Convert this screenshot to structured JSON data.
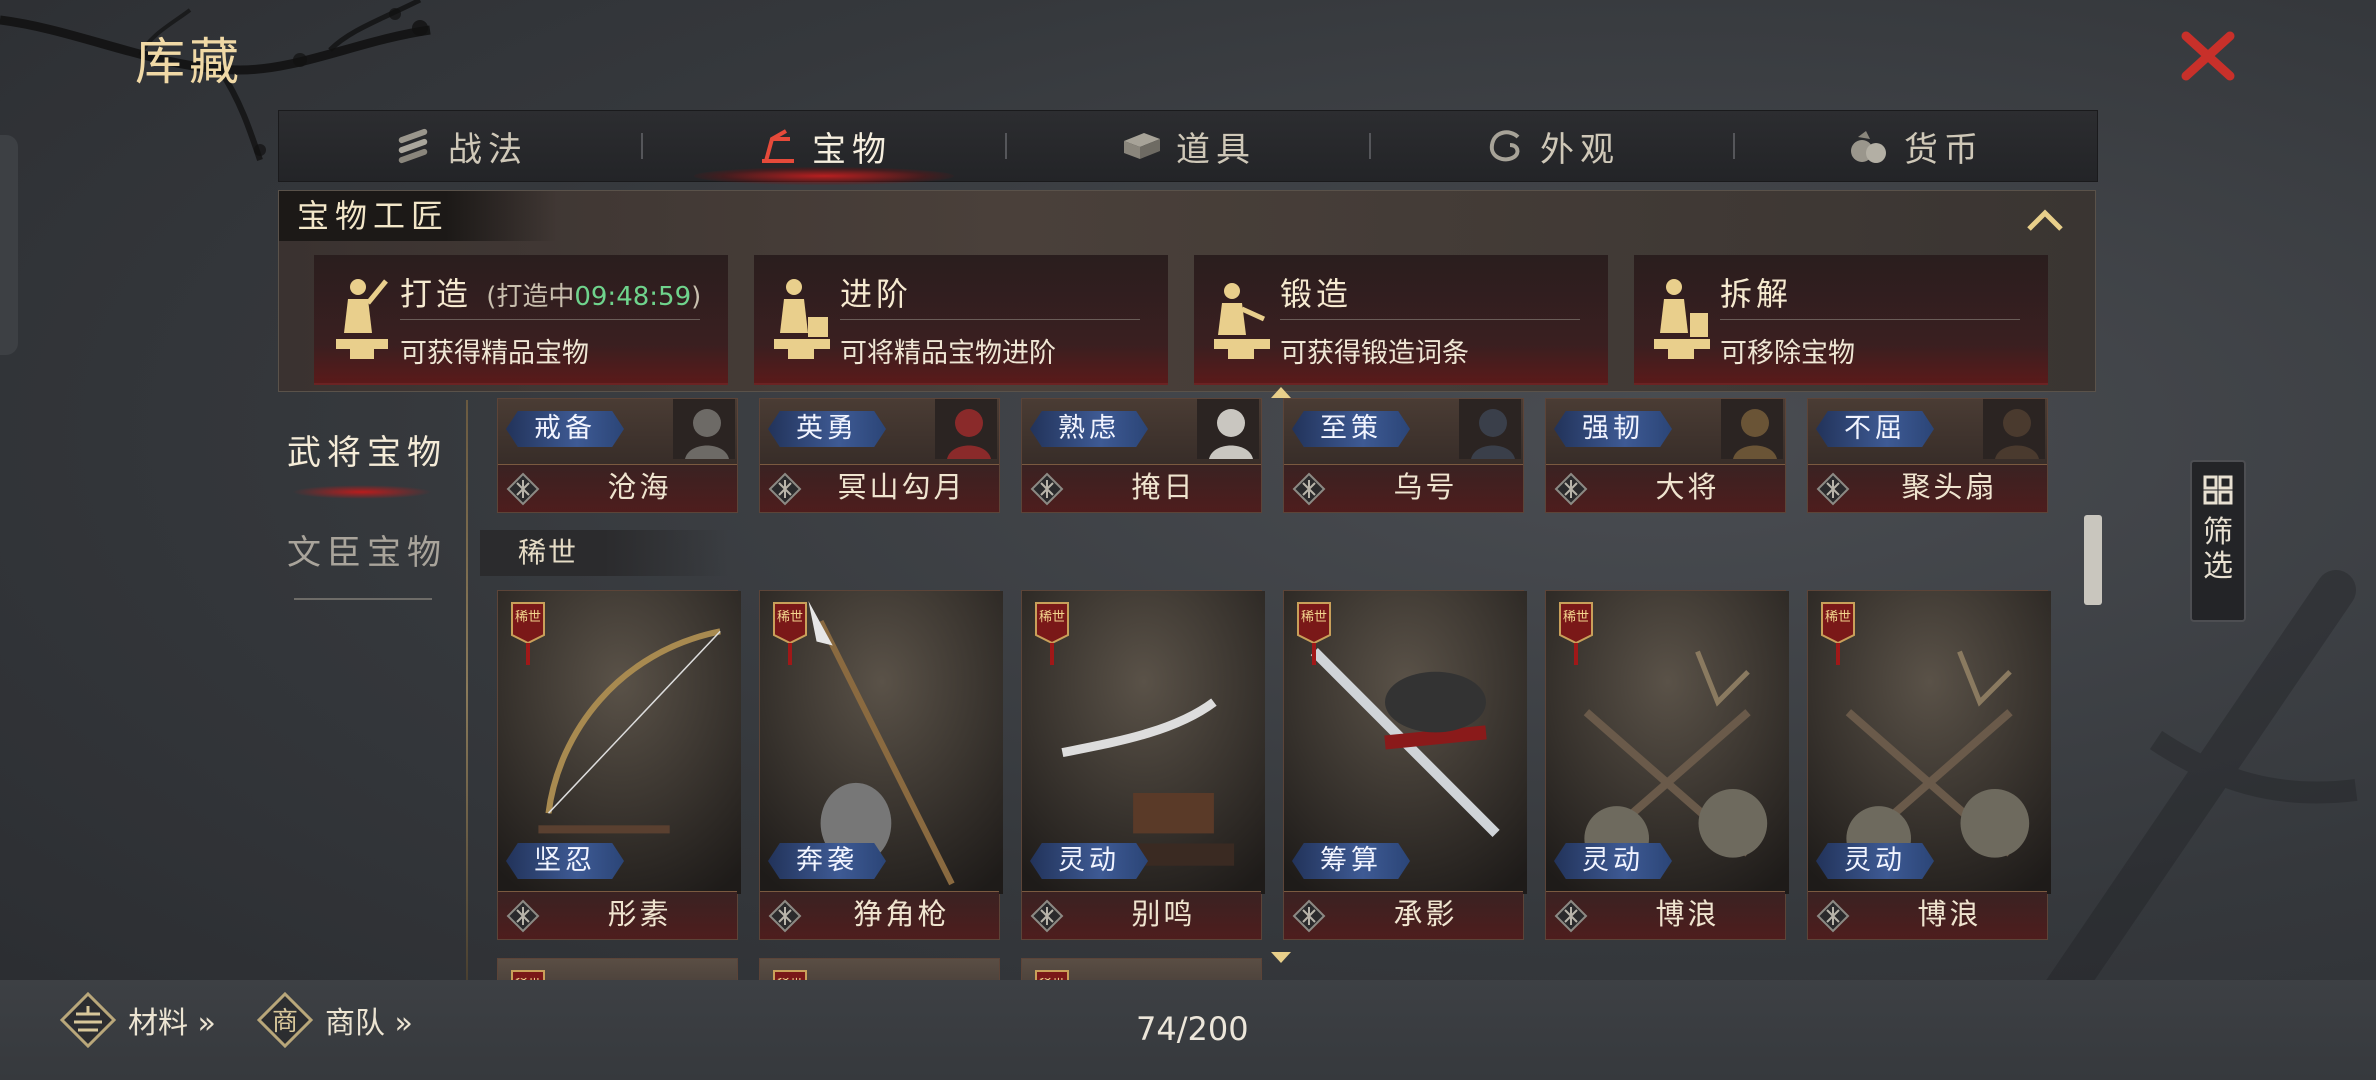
{
  "window": {
    "title": "库藏"
  },
  "tabs": [
    {
      "label": "战法",
      "icon": "scroll-bundle-icon",
      "active": false
    },
    {
      "label": "宝物",
      "icon": "treasure-icon",
      "active": true
    },
    {
      "label": "道具",
      "icon": "stack-icon",
      "active": false
    },
    {
      "label": "外观",
      "icon": "swirl-icon",
      "active": false
    },
    {
      "label": "货币",
      "icon": "coin-pouch-icon",
      "active": false
    }
  ],
  "craft": {
    "title": "宝物工匠",
    "cards": [
      {
        "name": "打造",
        "status_prefix": "(打造中",
        "status_time": "09:48:59",
        "status_suffix": ")",
        "desc": "可获得精品宝物"
      },
      {
        "name": "进阶",
        "desc": "可将精品宝物进阶"
      },
      {
        "name": "锻造",
        "desc": "可获得锻造词条"
      },
      {
        "name": "拆解",
        "desc": "可移除宝物"
      }
    ]
  },
  "sidebar": {
    "items": [
      {
        "label": "武将宝物",
        "active": true
      },
      {
        "label": "文臣宝物",
        "active": false
      }
    ]
  },
  "top_row": [
    {
      "skill": "戒备",
      "name": "沧海",
      "grade": "極"
    },
    {
      "skill": "英勇",
      "name": "冥山勾月",
      "grade": "極"
    },
    {
      "skill": "熟虑",
      "name": "掩日",
      "grade": "極"
    },
    {
      "skill": "至策",
      "name": "乌号",
      "grade": "極"
    },
    {
      "skill": "强韧",
      "name": "大将",
      "grade": "極"
    },
    {
      "skill": "不屈",
      "name": "聚头扇",
      "grade": "極"
    }
  ],
  "section": {
    "title": "稀世",
    "tag": "稀世"
  },
  "rare_row": [
    {
      "skill": "坚忍",
      "name": "彤素",
      "grade": "極",
      "art": "bow"
    },
    {
      "skill": "奔袭",
      "name": "狰角枪",
      "grade": "極",
      "art": "spear"
    },
    {
      "skill": "灵动",
      "name": "别鸣",
      "grade": "極",
      "art": "dagger"
    },
    {
      "skill": "筹算",
      "name": "承影",
      "grade": "極",
      "art": "sword"
    },
    {
      "skill": "灵动",
      "name": "博浪",
      "grade": "極",
      "art": "hammers"
    },
    {
      "skill": "灵动",
      "name": "博浪",
      "grade": "極",
      "art": "hammers"
    }
  ],
  "filter": {
    "label": "筛选"
  },
  "bottom": {
    "materials": "材料 »",
    "caravan": "商队 »",
    "caravan_glyph": "商",
    "count": "74/200"
  },
  "colors": {
    "accent_red": "#c81e1e",
    "timer_green": "#6fd38c",
    "gold": "#f0d9a6",
    "skill_blue": "#3e5a94"
  }
}
